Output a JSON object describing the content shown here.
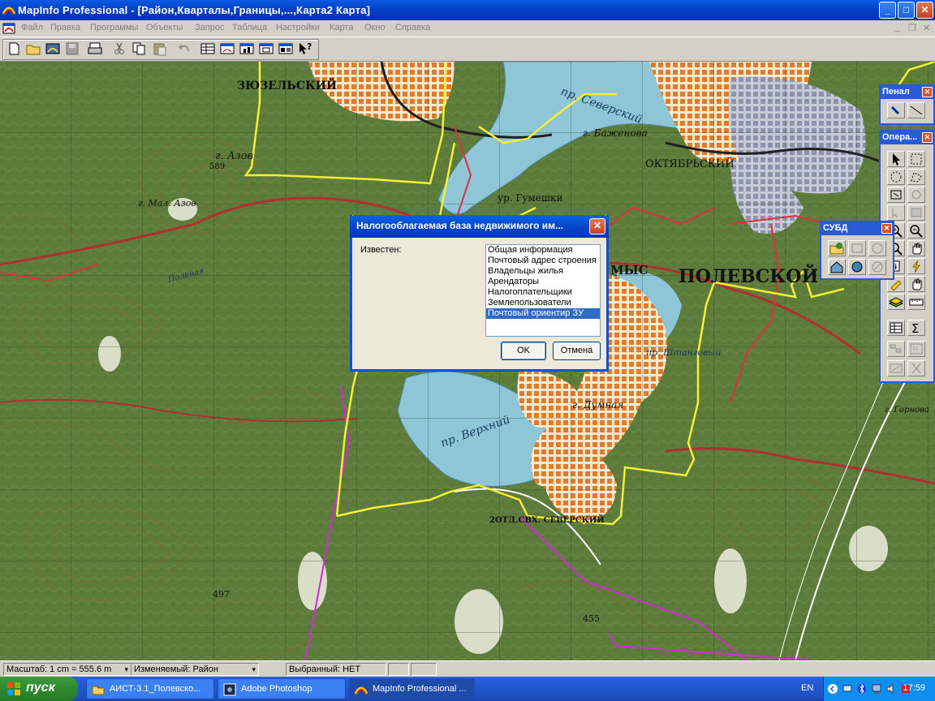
{
  "window": {
    "title": "MapInfo Professional - [Район,Кварталы,Границы,...,Карта2 Карта]",
    "minimize": "_",
    "maximize": "□",
    "close": "✕"
  },
  "menu": {
    "items": [
      "Файл",
      "Правка",
      "Программы",
      "Объекты",
      "Запрос",
      "Таблица",
      "Настройки",
      "Карта",
      "Окно",
      "Справка"
    ],
    "mdi_min": "_",
    "mdi_restore": "❐",
    "mdi_close": "✕"
  },
  "map": {
    "labels": {
      "zyuzelsky": "ЗЮЗЕЛЬСКИЙ",
      "oktyabrsky": "ОКТЯБРЬСКИЙ",
      "polevskoy": "ПОЛЕВСКОЙ",
      "severny_pond": "пр. Северский",
      "verkhny_pond": "пр. Верхний",
      "gora_azov": "г. Азов",
      "mal_azov": "г. Мал. Азов",
      "bazhenova": "г. Баженова",
      "gumeshki": "ур. Гумешки",
      "dumnaya": "г. Думная",
      "stoyanka": "пр. Штанговый",
      "gornovaya": "г. Горнова",
      "elev_589": "589",
      "elev_497": "497",
      "elev_455": "455",
      "severnyi_village": "2ОТД.СВХ. СЕВЕРСКИЙ",
      "polevaya": "Полевая",
      "mys": "МЫС"
    }
  },
  "palettes": {
    "penal": {
      "title": "Пенал",
      "close": "✕"
    },
    "operations": {
      "title": "Опера...",
      "close": "✕"
    },
    "subd": {
      "title": "СУБД",
      "close": "✕"
    }
  },
  "dialog": {
    "title": "Налогооблагаемая база  недвижимого им...",
    "close": "✕",
    "label": "Известен:",
    "list": [
      "Общая информация",
      "Почтовый адрес строения",
      "Владельцы жилья",
      "Арендаторы",
      "Налогоплательщики",
      "Землепользователи",
      "Почтовый ориентир ЗУ"
    ],
    "selected_index": 6,
    "ok": "OK",
    "cancel": "Отмена"
  },
  "statusbar": {
    "scale": "Масштаб: 1 cm = 555.6 m",
    "editable": "Изменяемый: Район",
    "selected": "Выбранный: НЕТ"
  },
  "taskbar": {
    "start": "пуск",
    "tasks": [
      "АИСТ-3.1_Полевско...",
      "Adobe Photoshop",
      "MapInfo Professional ..."
    ],
    "language": "EN",
    "clock": "17:59"
  },
  "colors": {
    "forest": "#5c7a3a",
    "water": "#8ec6d8",
    "urban": "#e68a3c",
    "yellow_boundary": "#f4f036",
    "magenta_boundary": "#d02cd0",
    "red_road": "#c8303a",
    "xp_blue": "#0a50d8"
  }
}
